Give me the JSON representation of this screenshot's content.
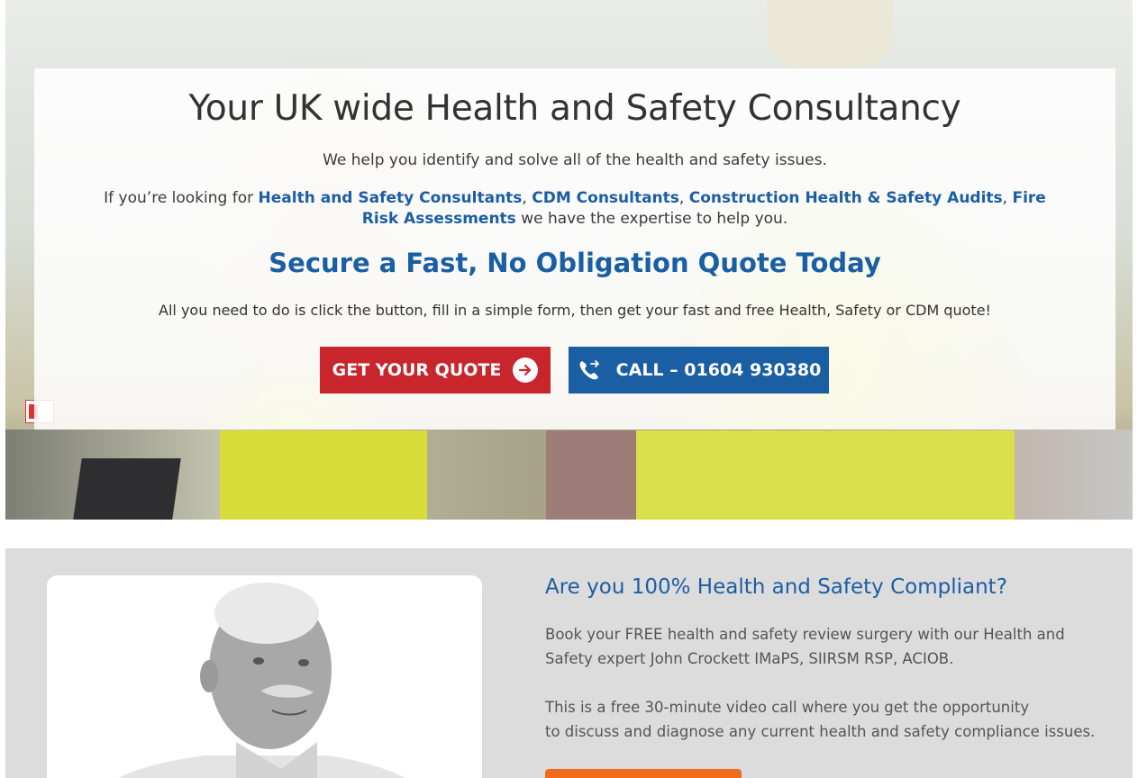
{
  "hero": {
    "title": "Your UK wide Health and Safety Consultancy",
    "subtitle": "We help you identify and solve all of the health and safety issues.",
    "looking_prefix": "If you’re looking for ",
    "links": [
      "Health and Safety Consultants",
      "CDM Consultants",
      "Construction Health & Safety Audits",
      "Fire Risk Assessments"
    ],
    "separator": ", ",
    "looking_suffix": " we have the expertise to help you.",
    "quote_heading": "Secure a Fast, No Obligation Quote Today",
    "instruction": "All you need to do is click the button, fill in a simple form, then get your fast and free Health, Safety or CDM quote!",
    "quote_button": "GET YOUR QUOTE",
    "call_button": "CALL – 01604 930380"
  },
  "compliance": {
    "heading": "Are you 100% Health and Safety Compliant?",
    "para1": "Book your FREE health and safety review surgery with our Health and Safety expert John Crockett IMaPS, SIIRSM RSP, ACIOB.",
    "para2_line1": "This is a free 30-minute video call where you get the opportunity",
    "para2_line2": "to discuss and diagnose any current health and safety compliance issues."
  },
  "icons": {
    "quote_arrow": "arrow-right-circle-icon",
    "call": "phone-icon"
  },
  "colors": {
    "brand_blue": "#1a5ea3",
    "quote_red": "#c8262c",
    "cta_orange": "#f26b1d",
    "section_grey": "#dcdcdc"
  }
}
